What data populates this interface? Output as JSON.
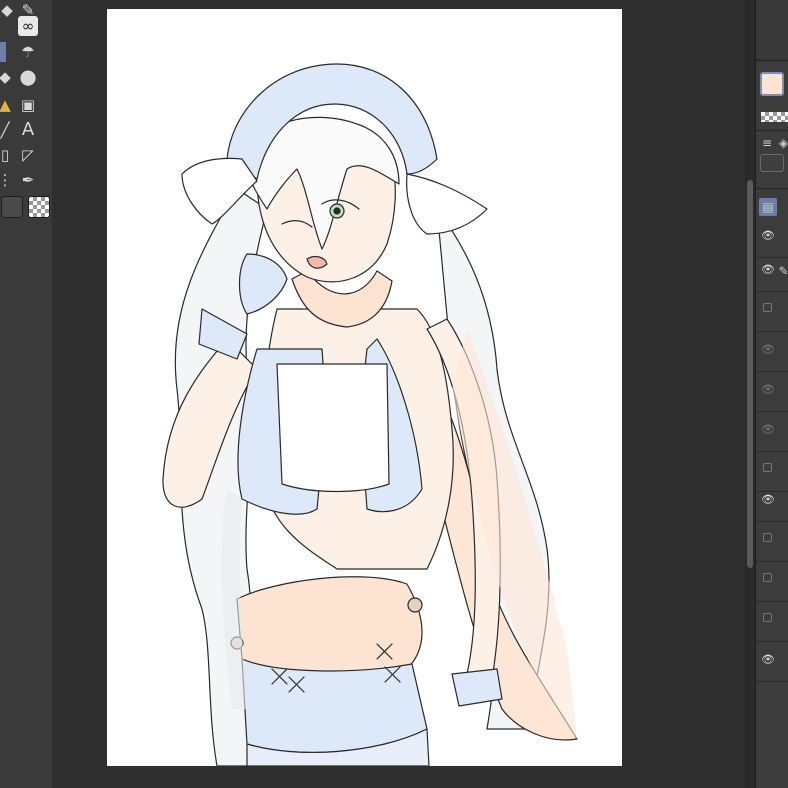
{
  "toolbar": {
    "tools": [
      {
        "name": "pen-icon",
        "glyph": "✎"
      },
      {
        "name": "lasso-icon",
        "glyph": "∞"
      },
      {
        "name": "airbrush-icon",
        "glyph": "☂"
      },
      {
        "name": "eraser-icon",
        "glyph": "◆"
      },
      {
        "name": "blend-icon",
        "glyph": "💧"
      },
      {
        "name": "gradient-icon",
        "glyph": "▣"
      },
      {
        "name": "text-tool-icon",
        "glyph": "A"
      },
      {
        "name": "balloon-icon",
        "glyph": "◸"
      },
      {
        "name": "eyedropper-icon",
        "glyph": "🖉"
      }
    ],
    "main_swatch_color": "#4a4a4a"
  },
  "colors": {
    "main_color": "#fde3d2",
    "accent": "#6c7fa8",
    "skin": "#fdeee3",
    "skin_shade": "#fbd7bf",
    "cloth_blue": "#dde9f8",
    "hair_shadow": "#eceeee",
    "eye_green": "#b7e3b3"
  },
  "layers": [
    {
      "visible": true,
      "icon": "eye-icon"
    },
    {
      "visible": true,
      "icon": "vector-pen-icon"
    },
    {
      "visible": false,
      "icon": "layer-checkbox-icon"
    },
    {
      "visible": false,
      "icon": "eye-icon"
    },
    {
      "visible": false,
      "icon": "eye-icon"
    },
    {
      "visible": false,
      "icon": "eye-icon"
    },
    {
      "visible": false,
      "icon": "layer-checkbox-icon"
    },
    {
      "visible": true,
      "icon": "eye-icon"
    },
    {
      "visible": false,
      "icon": "layer-checkbox-icon"
    },
    {
      "visible": false,
      "icon": "layer-checkbox-icon"
    },
    {
      "visible": false,
      "icon": "layer-checkbox-icon"
    },
    {
      "visible": true,
      "icon": "eye-icon"
    }
  ]
}
